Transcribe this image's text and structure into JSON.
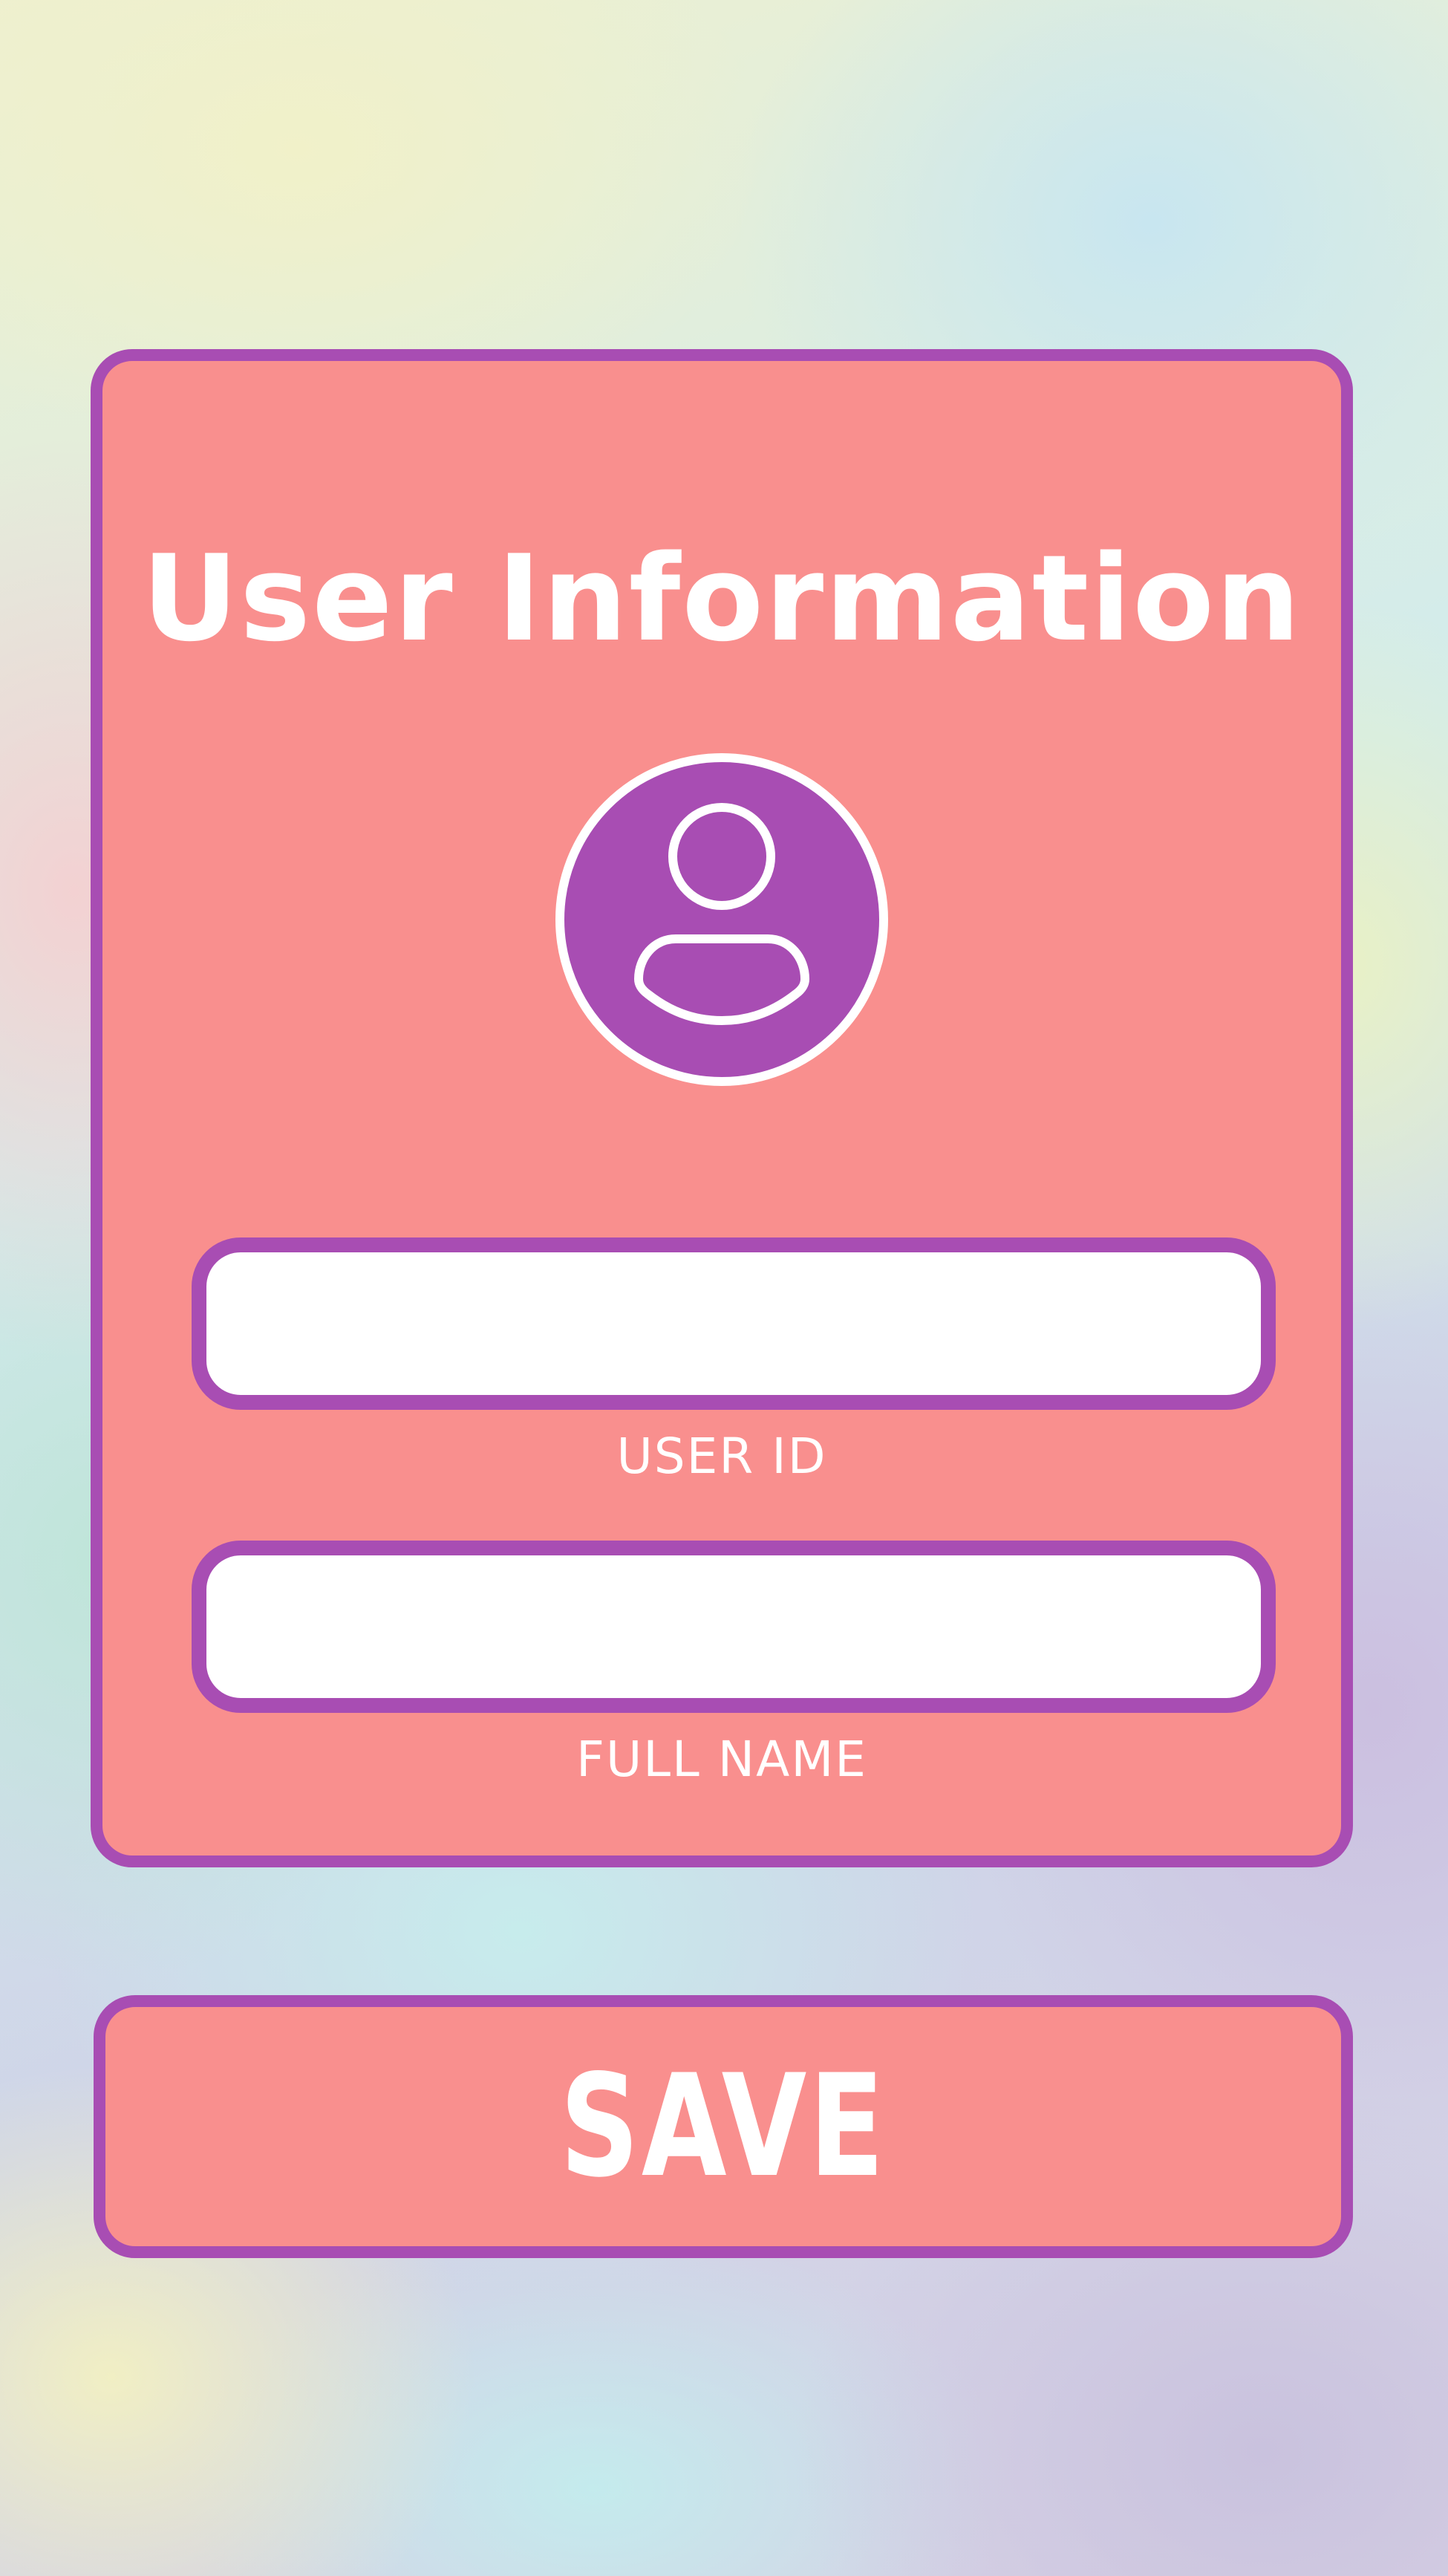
{
  "form": {
    "title": "User Information",
    "avatar_icon": "user-avatar-icon",
    "user_id": {
      "label": "USER ID",
      "value": "",
      "placeholder": ""
    },
    "full_name": {
      "label": "FULL NAME",
      "value": "",
      "placeholder": ""
    }
  },
  "actions": {
    "save_label": "SAVE"
  },
  "colors": {
    "card_fill": "#f98f8e",
    "accent_border": "#a84db3",
    "text": "#ffffff"
  }
}
